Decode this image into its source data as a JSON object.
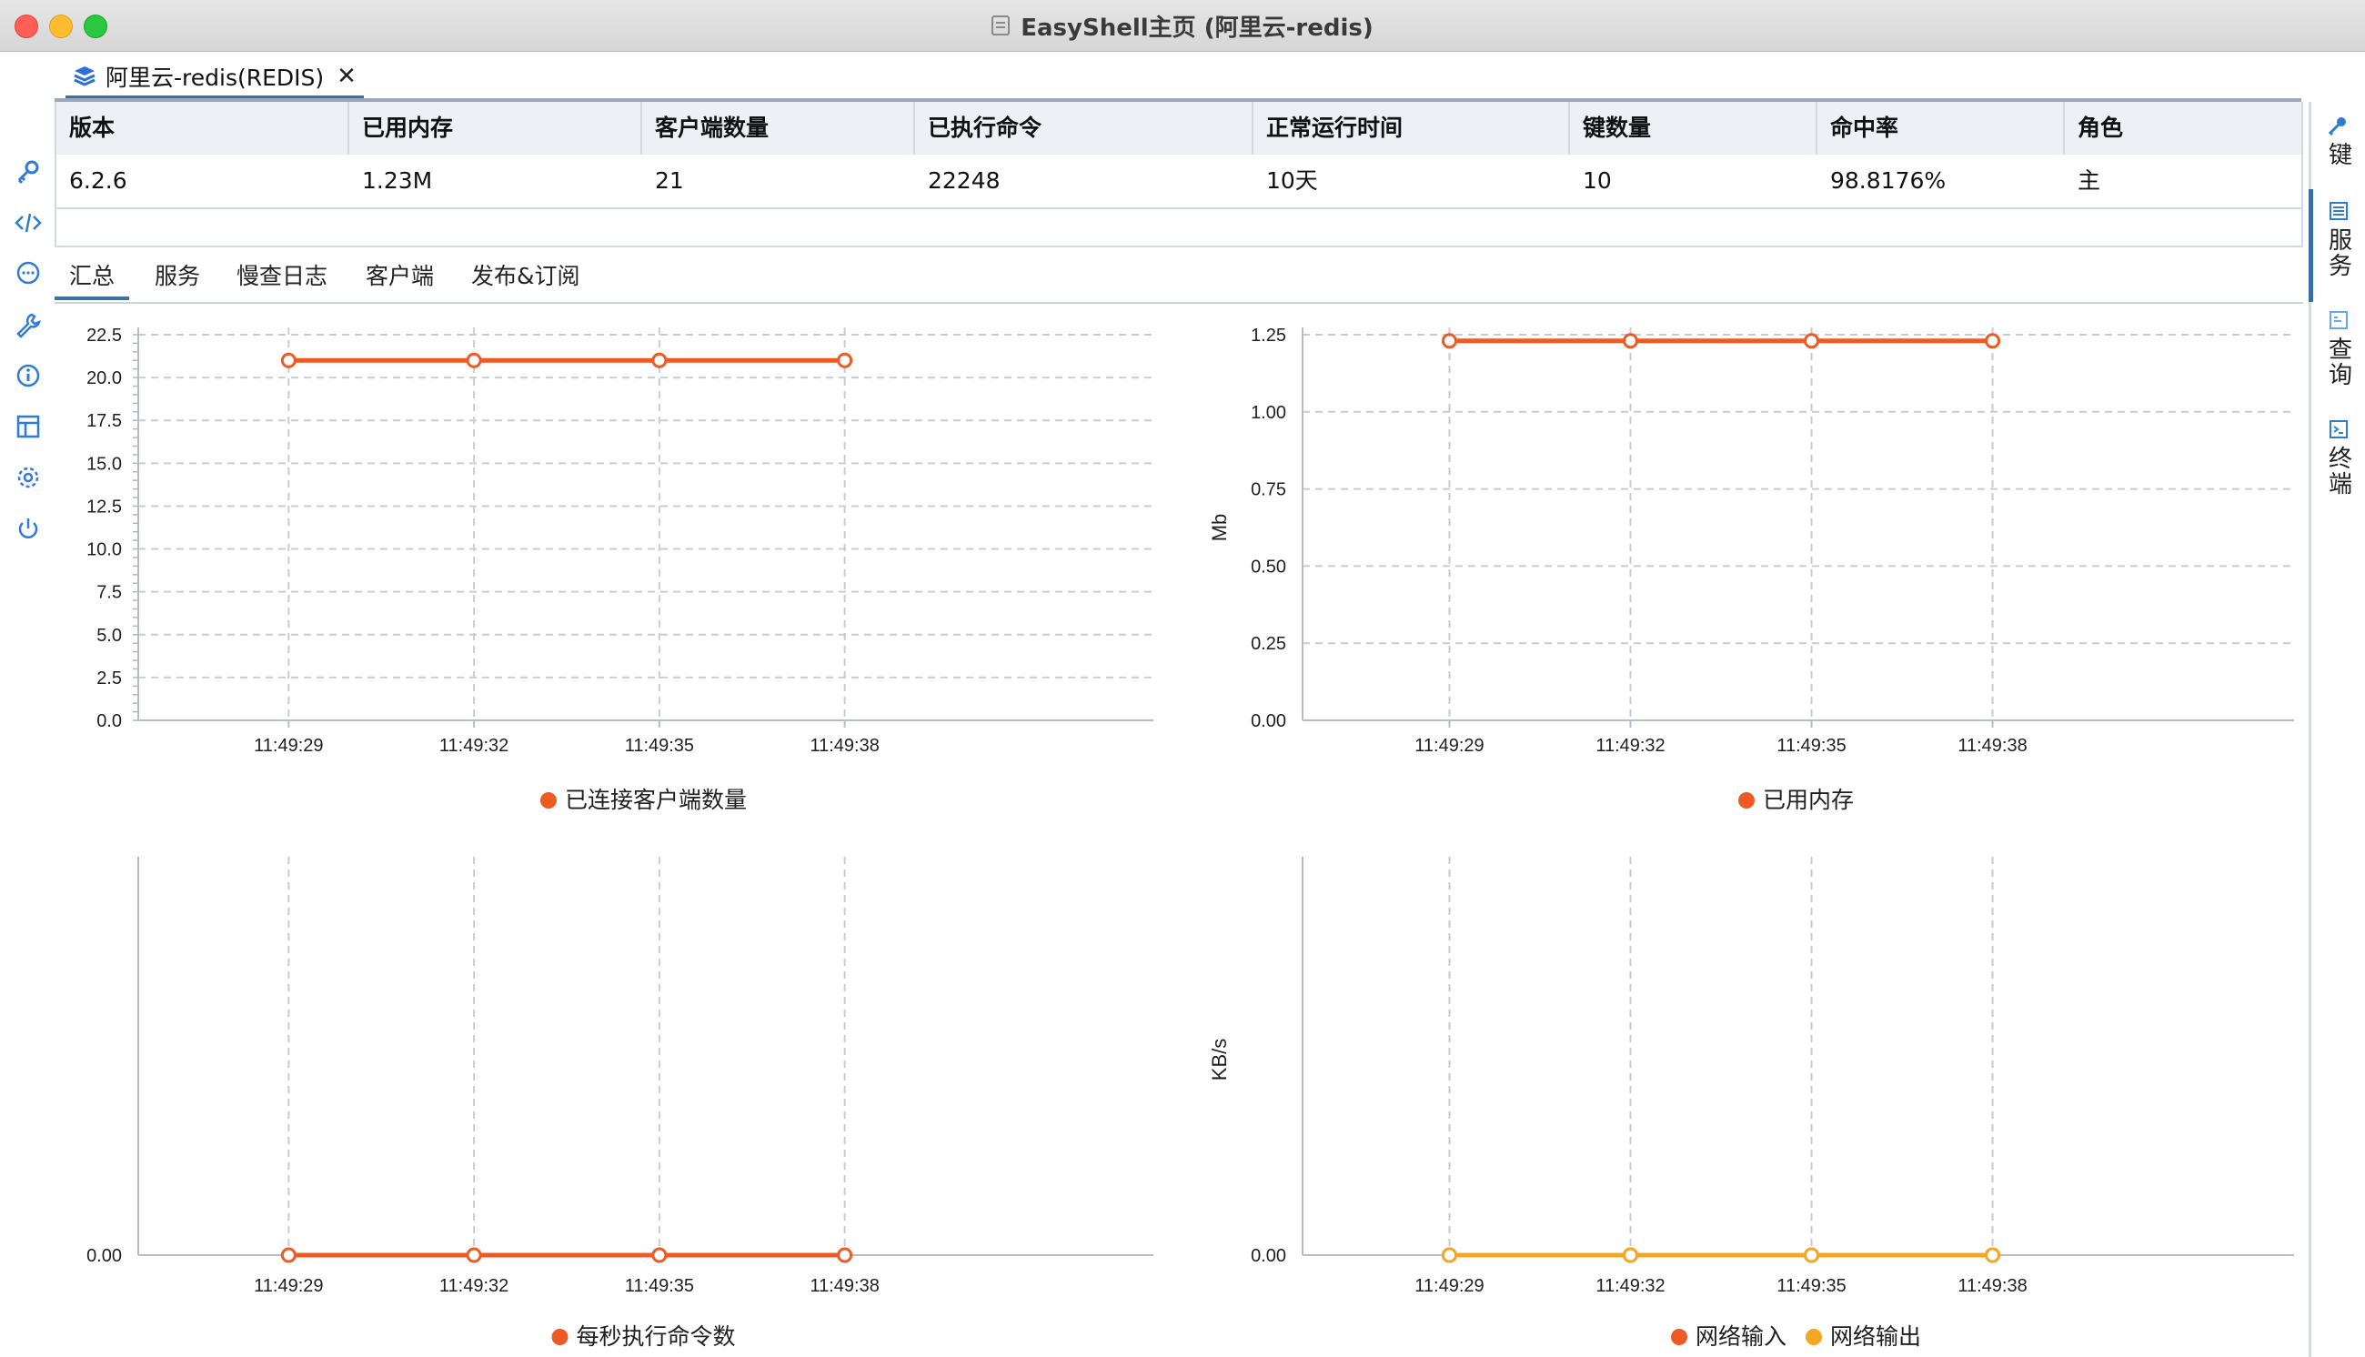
{
  "window": {
    "title": "EasyShell主页 (阿里云-redis)"
  },
  "doc_tab": {
    "label": "阿里云-redis(REDIS)",
    "close": "✕"
  },
  "info_table": {
    "headers": [
      "版本",
      "已用内存",
      "客户端数量",
      "已执行命令",
      "正常运行时间",
      "键数量",
      "命中率",
      "角色"
    ],
    "values": [
      "6.2.6",
      "1.23M",
      "21",
      "22248",
      "10天",
      "10",
      "98.8176%",
      "主"
    ]
  },
  "section_tabs": [
    {
      "label": "汇总",
      "active": true
    },
    {
      "label": "服务",
      "active": false
    },
    {
      "label": "慢查日志",
      "active": false
    },
    {
      "label": "客户端",
      "active": false
    },
    {
      "label": "发布&订阅",
      "active": false
    }
  ],
  "left_sidebar": {
    "icons": [
      "key-icon",
      "code-icon",
      "chat-icon",
      "wrench-icon",
      "info-icon",
      "layout-icon",
      "gear-icon",
      "power-icon"
    ]
  },
  "right_sidebar": {
    "items": [
      {
        "label": "键",
        "icon": "key-icon"
      },
      {
        "label": "服务",
        "icon": "server-icon"
      },
      {
        "label": "查询",
        "icon": "query-icon"
      },
      {
        "label": "终端",
        "icon": "terminal-icon"
      }
    ]
  },
  "colors": {
    "accent": "#3d6fa8",
    "series_orange": "#ee5a24",
    "series_yellow": "#f5a623",
    "grid": "#c8ccd4"
  },
  "chart_data": [
    {
      "type": "line",
      "x": [
        "11:49:29",
        "11:49:32",
        "11:49:35",
        "11:49:38"
      ],
      "series": [
        {
          "name": "已连接客户端数量",
          "values": [
            21,
            21,
            21,
            21
          ],
          "color": "#ee5a24"
        }
      ],
      "ylim": [
        0,
        22.5
      ],
      "yticks": [
        "0.0",
        "2.5",
        "5.0",
        "7.5",
        "10.0",
        "12.5",
        "15.0",
        "17.5",
        "20.0",
        "22.5"
      ],
      "ylabel": "",
      "grid": true,
      "legend": "bottom"
    },
    {
      "type": "line",
      "x": [
        "11:49:29",
        "11:49:32",
        "11:49:35",
        "11:49:38"
      ],
      "series": [
        {
          "name": "已用内存",
          "values": [
            1.23,
            1.23,
            1.23,
            1.23
          ],
          "color": "#ee5a24"
        }
      ],
      "ylim": [
        0,
        1.25
      ],
      "yticks": [
        "0.00",
        "0.25",
        "0.50",
        "0.75",
        "1.00",
        "1.25"
      ],
      "ylabel": "Mb",
      "grid": true,
      "legend": "bottom"
    },
    {
      "type": "line",
      "x": [
        "11:49:29",
        "11:49:32",
        "11:49:35",
        "11:49:38"
      ],
      "series": [
        {
          "name": "每秒执行命令数",
          "values": [
            0,
            0,
            0,
            0
          ],
          "color": "#ee5a24"
        }
      ],
      "yticks": [
        "0.00"
      ],
      "ylabel": "",
      "grid": true,
      "legend": "bottom"
    },
    {
      "type": "line",
      "x": [
        "11:49:29",
        "11:49:32",
        "11:49:35",
        "11:49:38"
      ],
      "series": [
        {
          "name": "网络输入",
          "values": [
            0,
            0,
            0,
            0
          ],
          "color": "#ee5a24"
        },
        {
          "name": "网络输出",
          "values": [
            0,
            0,
            0,
            0
          ],
          "color": "#f5a623"
        }
      ],
      "yticks": [
        "0.00"
      ],
      "ylabel": "KB/s",
      "grid": true,
      "legend": "bottom"
    }
  ]
}
